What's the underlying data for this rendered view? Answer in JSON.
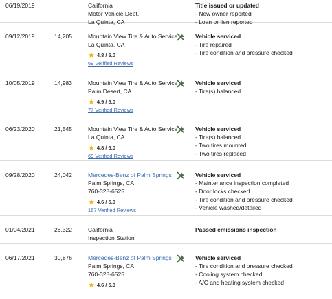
{
  "records": [
    {
      "date": "06/19/2019",
      "mileage": "",
      "source": [
        "California",
        "Motor Vehicle Dept.",
        "La Quinta, CA"
      ],
      "event_title": "Title issued or updated",
      "events": [
        "- New owner reported",
        "- Loan or lien reported"
      ]
    },
    {
      "date": "09/12/2019",
      "mileage": "14,205",
      "source": [
        "Mountain View Tire & Auto Service",
        "La Quinta, CA"
      ],
      "rating": "4.8 / 5.0",
      "reviews": "69 Verified Reviews",
      "event_title": "Vehicle serviced",
      "events": [
        "- Tire repaired",
        "- Tire condition and pressure checked"
      ]
    },
    {
      "date": "10/05/2019",
      "mileage": "14,983",
      "source": [
        "Mountain View Tire & Auto Service",
        "Palm Desert, CA"
      ],
      "rating": "4.9 / 5.0",
      "reviews": "77 Verified Reviews",
      "event_title": "Vehicle serviced",
      "events": [
        "- Tire(s) balanced"
      ]
    },
    {
      "date": "06/23/2020",
      "mileage": "21,545",
      "source": [
        "Mountain View Tire & Auto Service",
        "La Quinta, CA"
      ],
      "rating": "4.8 / 5.0",
      "reviews": "69 Verified Reviews",
      "event_title": "Vehicle serviced",
      "events": [
        "- Tire(s) balanced",
        "- Two tires mounted",
        "- Two tires replaced"
      ]
    },
    {
      "date": "09/28/2020",
      "mileage": "24,042",
      "source_link": "Mercedes-Benz of Palm Springs",
      "source": [
        "Palm Springs, CA",
        "760-328-6525"
      ],
      "rating": "4.6 / 5.0",
      "reviews": "167 Verified Reviews",
      "event_title": "Vehicle serviced",
      "events": [
        "- Maintenance inspection completed",
        "- Door locks checked",
        "- Tire condition and pressure checked",
        "- Vehicle washed/detailed"
      ]
    },
    {
      "date": "01/04/2021",
      "mileage": "26,322",
      "source": [
        "California",
        "Inspection Station"
      ],
      "event_title": "Passed emissions inspection",
      "events": []
    },
    {
      "date": "06/17/2021",
      "mileage": "30,876",
      "source_link": "Mercedes-Benz of Palm Springs",
      "source": [
        "Palm Springs, CA",
        "760-328-6525"
      ],
      "rating": "4.6 / 5.0",
      "reviews": "",
      "event_title": "Vehicle serviced",
      "events": [
        "- Tire condition and pressure checked",
        "- Cooling system checked",
        "- A/C and heating system checked"
      ]
    }
  ],
  "icons": {
    "service": "wrench-screwdriver-icon",
    "rating": "star-icon"
  },
  "colors": {
    "link": "#3a6bb0",
    "star": "#f2b01e",
    "icon": "#3f7a3a"
  }
}
